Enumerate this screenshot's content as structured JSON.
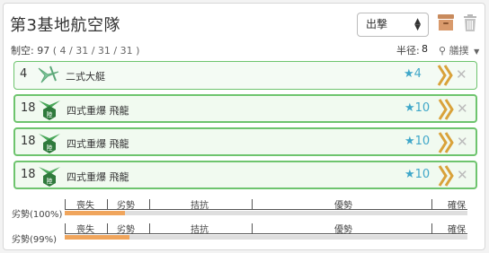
{
  "base": {
    "title": "第3基地航空隊",
    "action_select": "出撃",
    "air_power_label": "制空:",
    "air_power_value": "97",
    "air_power_detail": "( 4 / 31 / 31 / 31 )",
    "radius_label": "半径:",
    "radius_value": "8",
    "search_label": "艤撲",
    "icons": {
      "archive": "box-icon",
      "delete": "trash-icon",
      "search": "magnifier-icon",
      "dropdown": "triangle-down-icon"
    }
  },
  "slots": [
    {
      "count": "4",
      "icon": "recon-plane-icon",
      "name": "二式大艇",
      "proficiency": "★4"
    },
    {
      "count": "18",
      "icon": "land-attacker-icon",
      "name": "四式重爆 飛龍",
      "proficiency": "★10"
    },
    {
      "count": "18",
      "icon": "land-attacker-icon",
      "name": "四式重爆 飛龍",
      "proficiency": "★10"
    },
    {
      "count": "18",
      "icon": "land-attacker-icon",
      "name": "四式重爆 飛龍",
      "proficiency": "★10"
    }
  ],
  "air_states": [
    {
      "label": "劣勢(100%)",
      "progress": 0.15,
      "ticks": [
        "喪失",
        "劣勢",
        "拮抗",
        "優勢",
        "確保"
      ]
    },
    {
      "label": "劣勢(99%)",
      "progress": 0.16,
      "ticks": [
        "喪失",
        "劣勢",
        "拮抗",
        "優勢",
        "確保"
      ]
    }
  ],
  "colors": {
    "slot_border": "#6ec46e",
    "proficiency": "#3fa7c9",
    "chevron": "#d9a23a",
    "progress": "#f0a55c"
  }
}
